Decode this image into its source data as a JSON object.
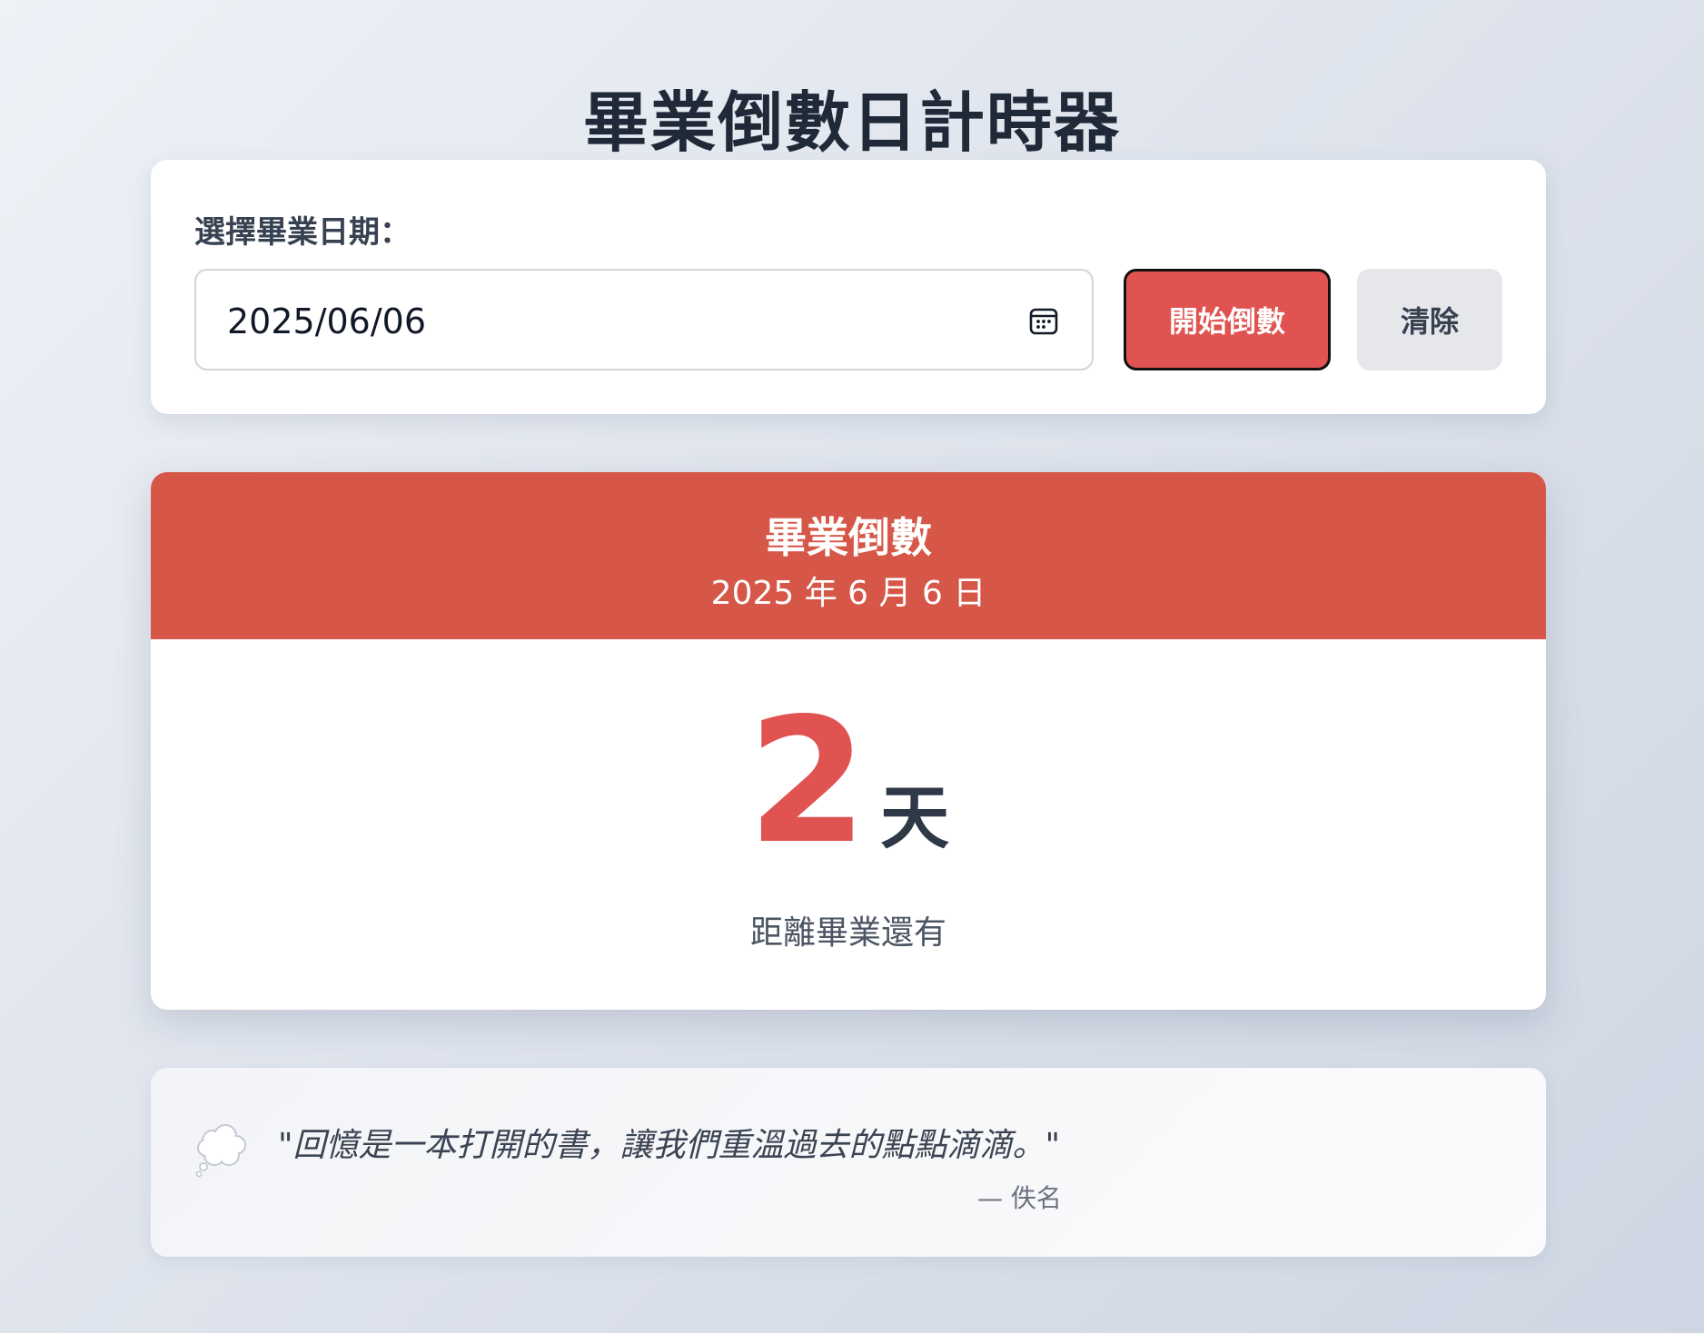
{
  "page": {
    "title": "畢業倒數日計時器"
  },
  "date_picker": {
    "label": "選擇畢業日期：",
    "value": "2025/06/06",
    "icon": "calendar-icon"
  },
  "actions": {
    "start_label": "開始倒數",
    "clear_label": "清除"
  },
  "countdown": {
    "title": "畢業倒數",
    "date_display": "2025 年 6 月 6 日",
    "days_value": "2",
    "days_unit": "天",
    "caption": "距離畢業還有"
  },
  "quote": {
    "icon": "thought-bubble-icon",
    "text": "\"回憶是一本打開的書，讓我們重溫過去的點點滴滴。\"",
    "author": "— 佚名"
  },
  "colors": {
    "accent": "#e05350",
    "header_bg": "#d65748",
    "clear_bg": "#e5e7eb"
  }
}
